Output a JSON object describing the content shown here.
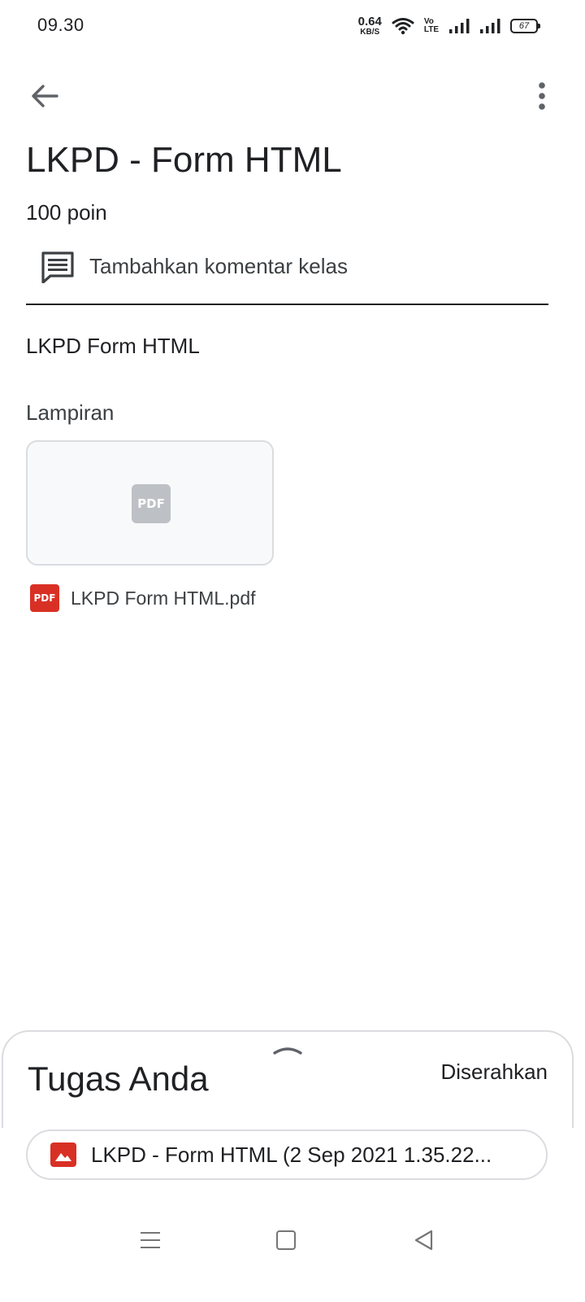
{
  "status_bar": {
    "time": "09.30",
    "net_speed_value": "0.64",
    "net_speed_unit": "KB/S",
    "volte_top": "Vo",
    "volte_bottom": "LTE",
    "battery": "67"
  },
  "header": {
    "back_icon": "arrow-back-icon",
    "more_icon": "more-vert-icon"
  },
  "assignment": {
    "title": "LKPD - Form HTML",
    "points": "100 poin",
    "class_comment_label": "Tambahkan komentar kelas",
    "description": "LKPD Form HTML"
  },
  "attachments": {
    "heading": "Lampiran",
    "thumb_label": "PDF",
    "file_badge": "PDF",
    "file_name": "LKPD Form HTML.pdf"
  },
  "your_work": {
    "title": "Tugas Anda",
    "status": "Diserahkan",
    "file_label": "LKPD - Form HTML (2 Sep 2021 1.35.22..."
  },
  "colors": {
    "accent_red": "#d93025",
    "text_primary": "#202124",
    "border": "#dadce0"
  }
}
